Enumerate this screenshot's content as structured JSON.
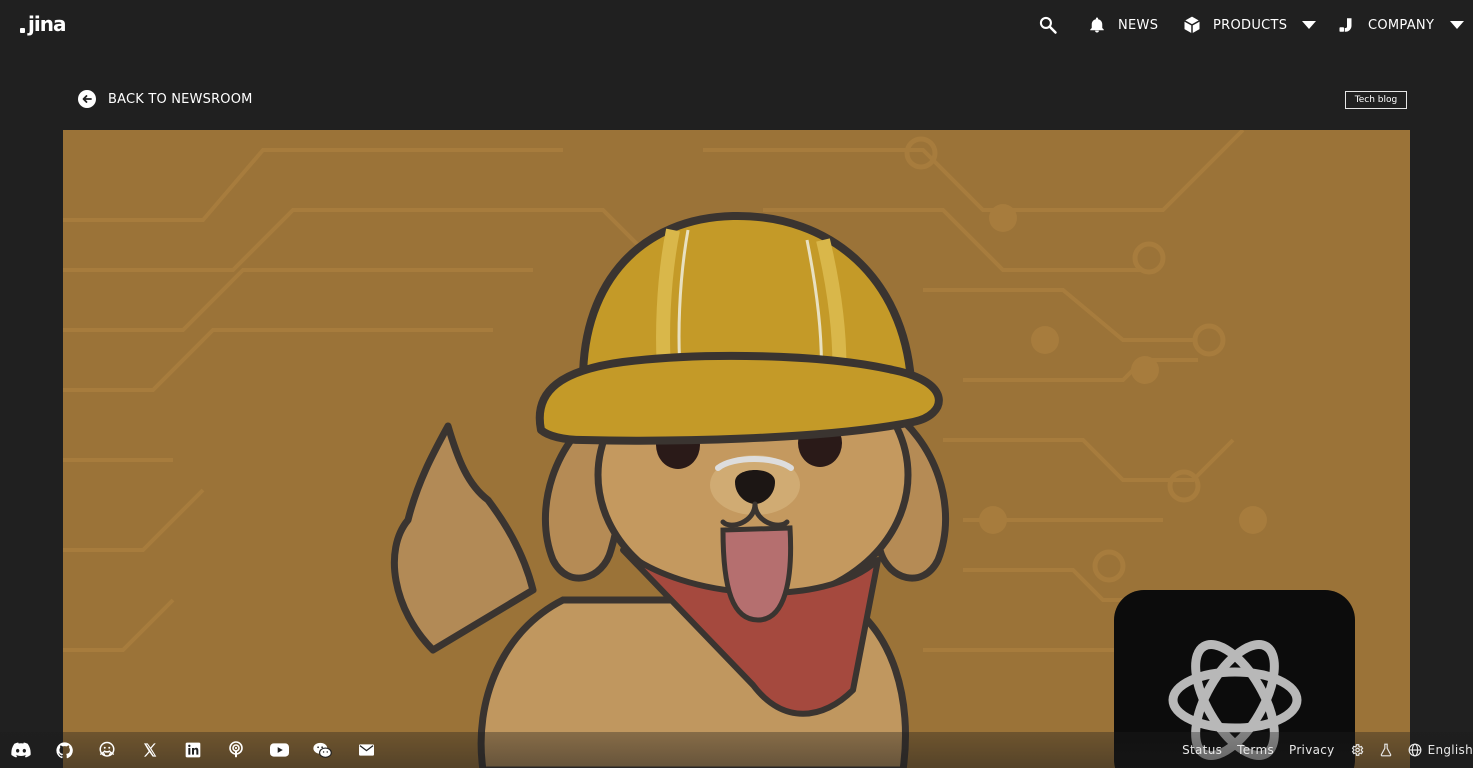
{
  "header": {
    "logo_text": "jina",
    "nav": {
      "news_label": "NEWS",
      "products_label": "PRODUCTS",
      "company_label": "COMPANY"
    }
  },
  "article": {
    "back_label": "BACK TO NEWSROOM",
    "tag_label": "Tech blog"
  },
  "hero_icons": [
    "golden-retriever-mascot",
    "hard-hat",
    "openai-logo",
    "circuit-pattern"
  ],
  "footer": {
    "social_icons": [
      "discord-icon",
      "github-icon",
      "huggingface-icon",
      "x-icon",
      "linkedin-icon",
      "podcast-icon",
      "youtube-icon",
      "wechat-icon",
      "email-icon"
    ],
    "links": {
      "status": "Status",
      "terms": "Terms",
      "privacy": "Privacy",
      "language": "English"
    }
  },
  "colors": {
    "background": "#202020",
    "hero_orange": "#9b7338",
    "text": "#ffffff"
  }
}
